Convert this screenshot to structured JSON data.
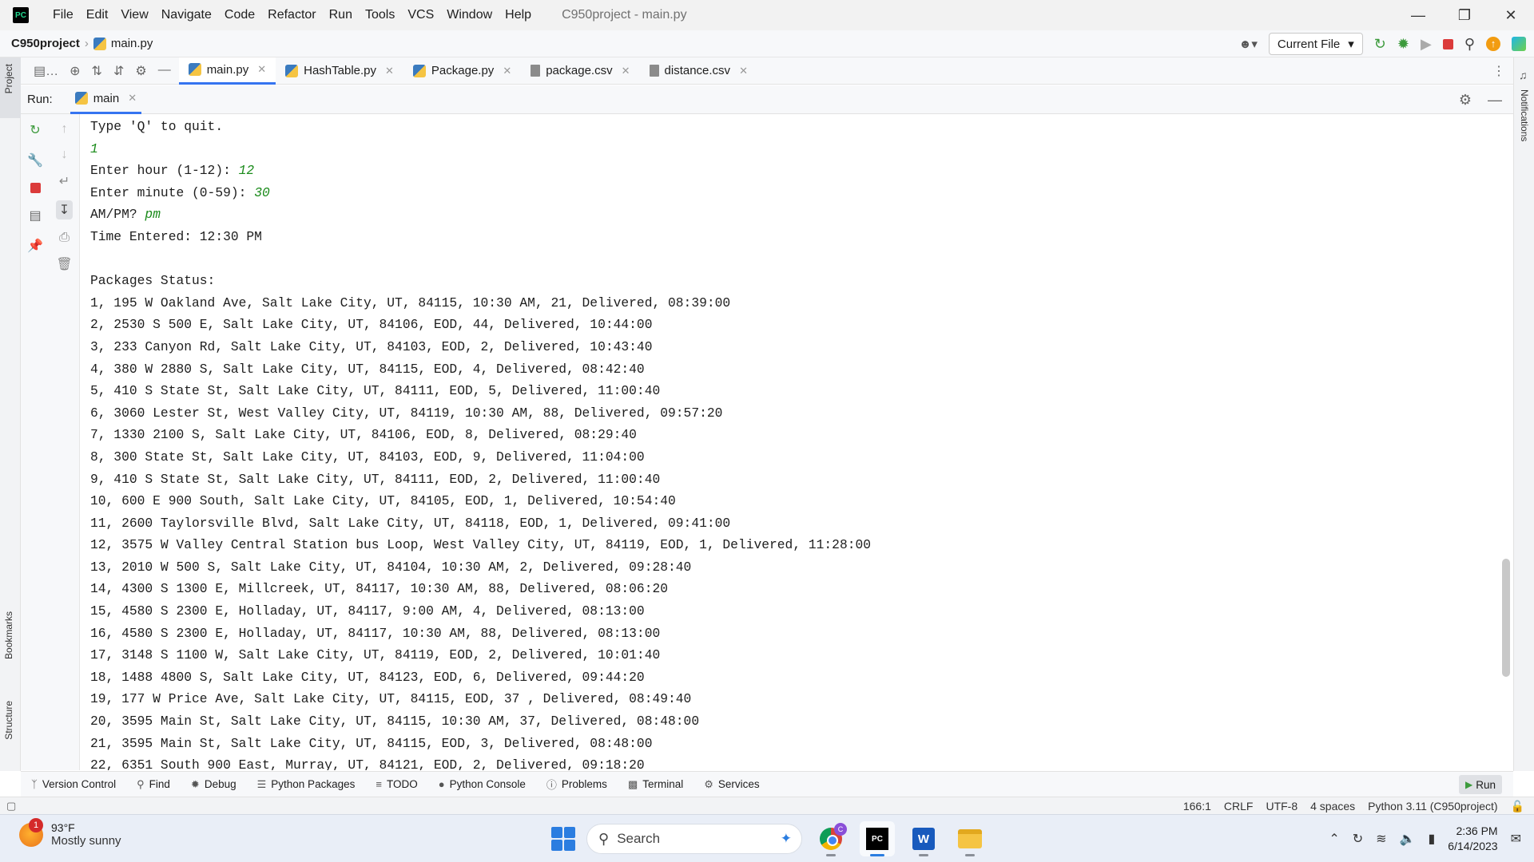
{
  "titlebar": {
    "logo_text": "PC",
    "menu": [
      "File",
      "Edit",
      "View",
      "Navigate",
      "Code",
      "Refactor",
      "Run",
      "Tools",
      "VCS",
      "Window",
      "Help"
    ],
    "window_title": "C950project - main.py"
  },
  "navbar": {
    "project": "C950project",
    "file": "main.py",
    "run_config": "Current File"
  },
  "side": {
    "project_label": "Project",
    "bookmarks_label": "Bookmarks",
    "structure_label": "Structure",
    "notifications_label": "Notifications"
  },
  "tabs": [
    {
      "label": "main.py",
      "type": "py",
      "active": true
    },
    {
      "label": "HashTable.py",
      "type": "py",
      "active": false
    },
    {
      "label": "Package.py",
      "type": "py",
      "active": false
    },
    {
      "label": "package.csv",
      "type": "csv",
      "active": false
    },
    {
      "label": "distance.csv",
      "type": "csv",
      "active": false
    }
  ],
  "run": {
    "label": "Run:",
    "tab": "main"
  },
  "console": {
    "lines": [
      {
        "t": "Type 'Q' to quit."
      },
      {
        "t": "",
        "i": "1"
      },
      {
        "t": "Enter hour (1-12): ",
        "i": "12"
      },
      {
        "t": "Enter minute (0-59): ",
        "i": "30"
      },
      {
        "t": "AM/PM? ",
        "i": "pm"
      },
      {
        "t": "Time Entered: 12:30 PM"
      },
      {
        "t": ""
      },
      {
        "t": "Packages Status:"
      },
      {
        "t": "1, 195 W Oakland Ave, Salt Lake City, UT, 84115, 10:30 AM, 21, Delivered, 08:39:00"
      },
      {
        "t": "2, 2530 S 500 E, Salt Lake City, UT, 84106, EOD, 44, Delivered, 10:44:00"
      },
      {
        "t": "3, 233 Canyon Rd, Salt Lake City, UT, 84103, EOD, 2, Delivered, 10:43:40"
      },
      {
        "t": "4, 380 W 2880 S, Salt Lake City, UT, 84115, EOD, 4, Delivered, 08:42:40"
      },
      {
        "t": "5, 410 S State St, Salt Lake City, UT, 84111, EOD, 5, Delivered, 11:00:40"
      },
      {
        "t": "6, 3060 Lester St, West Valley City, UT, 84119, 10:30 AM, 88, Delivered, 09:57:20"
      },
      {
        "t": "7, 1330 2100 S, Salt Lake City, UT, 84106, EOD, 8, Delivered, 08:29:40"
      },
      {
        "t": "8, 300 State St, Salt Lake City, UT, 84103, EOD, 9, Delivered, 11:04:00"
      },
      {
        "t": "9, 410 S State St, Salt Lake City, UT, 84111, EOD, 2, Delivered, 11:00:40"
      },
      {
        "t": "10, 600 E 900 South, Salt Lake City, UT, 84105, EOD, 1, Delivered, 10:54:40"
      },
      {
        "t": "11, 2600 Taylorsville Blvd, Salt Lake City, UT, 84118, EOD, 1, Delivered, 09:41:00"
      },
      {
        "t": "12, 3575 W Valley Central Station bus Loop, West Valley City, UT, 84119, EOD, 1, Delivered, 11:28:00"
      },
      {
        "t": "13, 2010 W 500 S, Salt Lake City, UT, 84104, 10:30 AM, 2, Delivered, 09:28:40"
      },
      {
        "t": "14, 4300 S 1300 E, Millcreek, UT, 84117, 10:30 AM, 88, Delivered, 08:06:20"
      },
      {
        "t": "15, 4580 S 2300 E, Holladay, UT, 84117, 9:00 AM, 4, Delivered, 08:13:00"
      },
      {
        "t": "16, 4580 S 2300 E, Holladay, UT, 84117, 10:30 AM, 88, Delivered, 08:13:00"
      },
      {
        "t": "17, 3148 S 1100 W, Salt Lake City, UT, 84119, EOD, 2, Delivered, 10:01:40"
      },
      {
        "t": "18, 1488 4800 S, Salt Lake City, UT, 84123, EOD, 6, Delivered, 09:44:20"
      },
      {
        "t": "19, 177 W Price Ave, Salt Lake City, UT, 84115, EOD, 37 , Delivered, 08:49:40"
      },
      {
        "t": "20, 3595 Main St, Salt Lake City, UT, 84115, 10:30 AM, 37, Delivered, 08:48:00"
      },
      {
        "t": "21, 3595 Main St, Salt Lake City, UT, 84115, EOD, 3, Delivered, 08:48:00"
      },
      {
        "t": "22, 6351 South 900 East, Murray, UT, 84121, EOD, 2, Delivered, 09:18:20"
      }
    ]
  },
  "toolwindows": [
    {
      "label": "Version Control",
      "icon": "branch-icon"
    },
    {
      "label": "Find",
      "icon": "search-icon"
    },
    {
      "label": "Debug",
      "icon": "bug-icon"
    },
    {
      "label": "Python Packages",
      "icon": "layers-icon"
    },
    {
      "label": "TODO",
      "icon": "list-icon"
    },
    {
      "label": "Python Console",
      "icon": "python-icon"
    },
    {
      "label": "Problems",
      "icon": "info-icon"
    },
    {
      "label": "Terminal",
      "icon": "terminal-icon"
    },
    {
      "label": "Services",
      "icon": "services-icon"
    }
  ],
  "toolwindow_run": "Run",
  "status": {
    "position": "166:1",
    "line_sep": "CRLF",
    "encoding": "UTF-8",
    "indent": "4 spaces",
    "interpreter": "Python 3.11 (C950project)"
  },
  "taskbar": {
    "weather_badge": "1",
    "temp": "93°F",
    "condition": "Mostly sunny",
    "search": "Search",
    "chrome_badge": "C",
    "pycharm_text": "PC",
    "word_text": "W",
    "time": "2:36 PM",
    "date": "6/14/2023"
  }
}
